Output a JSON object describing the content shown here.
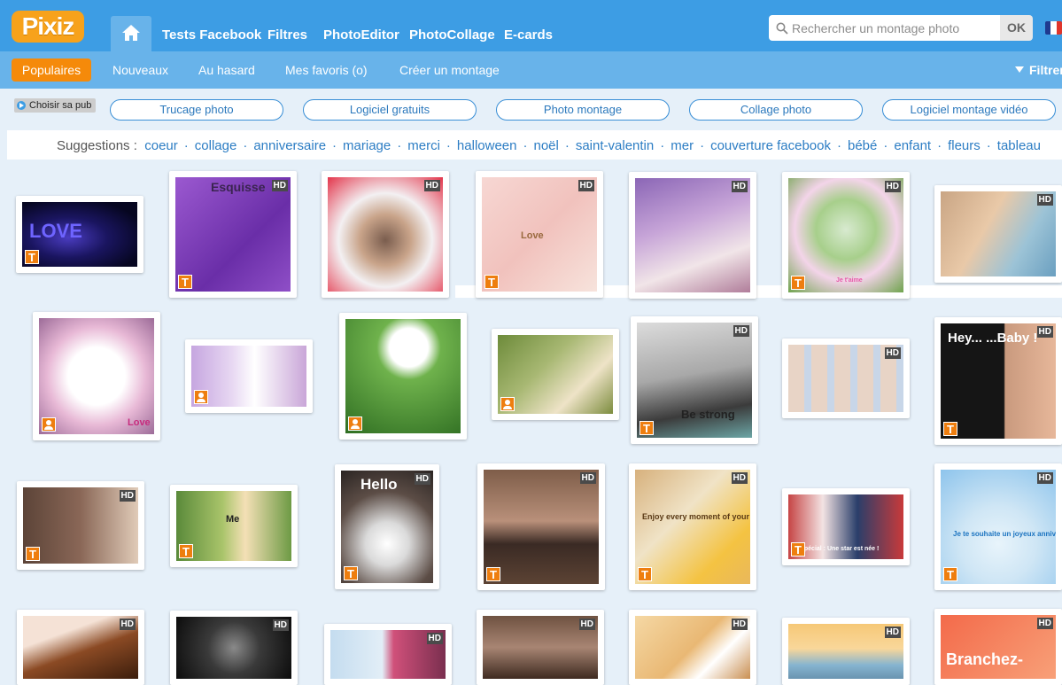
{
  "header": {
    "logo_text": "Pixiz",
    "nav": [
      "Tests Facebook",
      "Filtres",
      "PhotoEditor",
      "PhotoCollage",
      "E-cards"
    ],
    "search_placeholder": "Rechercher un montage photo",
    "search_button": "OK"
  },
  "subnav": {
    "items": [
      "Populaires",
      "Nouveaux",
      "Au hasard",
      "Mes favoris (o)",
      "Créer un montage"
    ],
    "filter_label": "Filtrer"
  },
  "pub_button": "Choisir sa pub",
  "pills": [
    "Trucage photo",
    "Logiciel gratuits",
    "Photo montage",
    "Collage photo",
    "Logiciel montage vidéo"
  ],
  "suggestions": {
    "label": "Suggestions :",
    "tags": [
      "coeur",
      "collage",
      "anniversaire",
      "mariage",
      "merci",
      "halloween",
      "noël",
      "saint-valentin",
      "mer",
      "couverture facebook",
      "bébé",
      "enfant",
      "fleurs",
      "tableau"
    ]
  },
  "cards": [
    {
      "hd": "",
      "badge": "T",
      "text": "LOVE"
    },
    {
      "hd": "HD",
      "badge": "T",
      "text": "Esquisse"
    },
    {
      "hd": "HD",
      "badge": "",
      "text": ""
    },
    {
      "hd": "HD",
      "badge": "T",
      "text": "Love"
    },
    {
      "hd": "HD",
      "badge": "",
      "text": ""
    },
    {
      "hd": "HD",
      "badge": "T",
      "text": "Je t'aime"
    },
    {
      "hd": "HD",
      "badge": "",
      "text": ""
    },
    {
      "hd": "",
      "badge": "P",
      "text": "Love"
    },
    {
      "hd": "",
      "badge": "P",
      "text": ""
    },
    {
      "hd": "",
      "badge": "P",
      "text": ""
    },
    {
      "hd": "",
      "badge": "P",
      "text": ""
    },
    {
      "hd": "HD",
      "badge": "T",
      "text": "Be strong"
    },
    {
      "hd": "HD",
      "badge": "",
      "text": ""
    },
    {
      "hd": "HD",
      "badge": "T",
      "text": "Hey... ...Baby !"
    },
    {
      "hd": "HD",
      "badge": "T",
      "text": ""
    },
    {
      "hd": "",
      "badge": "T",
      "text": "Me"
    },
    {
      "hd": "HD",
      "badge": "T",
      "text": "Hello"
    },
    {
      "hd": "HD",
      "badge": "T",
      "text": ""
    },
    {
      "hd": "HD",
      "badge": "T",
      "text": "Enjoy every moment of your life"
    },
    {
      "hd": "",
      "badge": "T",
      "text": "spécial : Une star est née !"
    },
    {
      "hd": "HD",
      "badge": "T",
      "text": "Je te souhaite un joyeux anniversaire"
    },
    {
      "hd": "HD",
      "badge": "",
      "text": ""
    },
    {
      "hd": "HD",
      "badge": "",
      "text": ""
    },
    {
      "hd": "HD",
      "badge": "",
      "text": ""
    },
    {
      "hd": "HD",
      "badge": "",
      "text": ""
    },
    {
      "hd": "HD",
      "badge": "",
      "text": ""
    },
    {
      "hd": "HD",
      "badge": "",
      "text": ""
    },
    {
      "hd": "HD",
      "badge": "",
      "text": "Branchez-"
    }
  ],
  "colors": {
    "topbar": "#3d9de4",
    "subbar": "#68b3ea",
    "accent": "#f58a0a",
    "link": "#2c7dc4"
  },
  "icons": {
    "home": "home-icon",
    "search": "search-icon",
    "flag": "french-flag-icon"
  }
}
